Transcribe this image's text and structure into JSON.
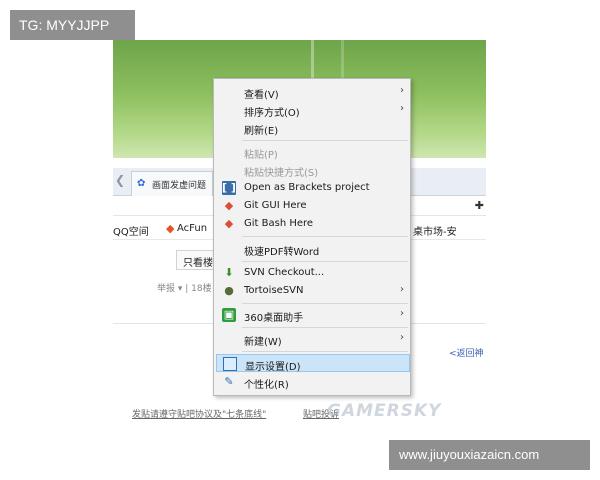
{
  "watermarks": {
    "tg": "TG: MYYJJPP",
    "site": "www.jiuyouxiazaicn.com"
  },
  "browser": {
    "tab_title": "画面发虚问题",
    "bookmarks": [
      "QQ空间",
      "AcFun",
      "桌市场-安"
    ],
    "filter_button": "只看楼",
    "meta_text": "举报 ▾ | 18楼",
    "back_link": "<返回神",
    "footer_tip": "发贴请遵守贴吧协议及\"七条底线\"",
    "footer_link": "贴吧投诉",
    "logo_text": "GAMERSKY"
  },
  "context_menu": {
    "items": [
      {
        "label": "查看(V)",
        "submenu": true,
        "icon": "",
        "disabled": false
      },
      {
        "label": "排序方式(O)",
        "submenu": true,
        "icon": "",
        "disabled": false
      },
      {
        "label": "刷新(E)",
        "submenu": false,
        "icon": "",
        "disabled": false
      },
      {
        "label": "粘贴(P)",
        "submenu": false,
        "icon": "",
        "disabled": true
      },
      {
        "label": "粘贴快捷方式(S)",
        "submenu": false,
        "icon": "",
        "disabled": true
      },
      {
        "label": "Open as Brackets project",
        "submenu": false,
        "icon": "brackets-icon",
        "disabled": false
      },
      {
        "label": "Git GUI Here",
        "submenu": false,
        "icon": "git-icon",
        "disabled": false
      },
      {
        "label": "Git Bash Here",
        "submenu": false,
        "icon": "git-icon",
        "disabled": false
      },
      {
        "label": "极速PDF转Word",
        "submenu": false,
        "icon": "",
        "disabled": false
      },
      {
        "label": "SVN Checkout...",
        "submenu": false,
        "icon": "svn-checkout-icon",
        "disabled": false
      },
      {
        "label": "TortoiseSVN",
        "submenu": true,
        "icon": "tortoise-icon",
        "disabled": false
      },
      {
        "label": "360桌面助手",
        "submenu": true,
        "icon": "desktop-360-icon",
        "disabled": false
      },
      {
        "label": "新建(W)",
        "submenu": true,
        "icon": "",
        "disabled": false
      },
      {
        "label": "显示设置(D)",
        "submenu": false,
        "icon": "display-icon",
        "disabled": false,
        "active": true
      },
      {
        "label": "个性化(R)",
        "submenu": false,
        "icon": "personalize-icon",
        "disabled": false
      }
    ]
  },
  "colors": {
    "menu_bg": "#f2f2f2",
    "highlight": "#cce4f7",
    "disabled_text": "#9a9a9a"
  }
}
